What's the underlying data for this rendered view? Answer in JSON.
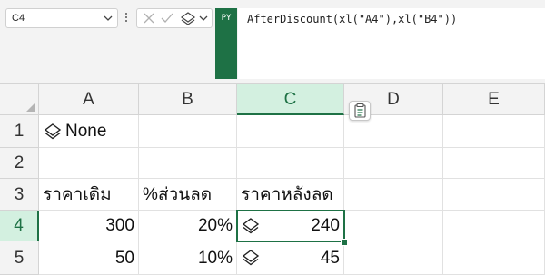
{
  "formula_bar": {
    "name_box": "C4",
    "py_badge": "PY",
    "formula": "AfterDiscount(xl(\"A4\"),xl(\"B4\"))"
  },
  "columns": [
    {
      "label": "A",
      "selected": false
    },
    {
      "label": "B",
      "selected": false
    },
    {
      "label": "C",
      "selected": true
    },
    {
      "label": "D",
      "selected": false
    },
    {
      "label": "E",
      "selected": false
    }
  ],
  "rows": [
    {
      "label": "1",
      "selected": false
    },
    {
      "label": "2",
      "selected": false
    },
    {
      "label": "3",
      "selected": false
    },
    {
      "label": "4",
      "selected": true
    },
    {
      "label": "5",
      "selected": false
    }
  ],
  "cells": {
    "A1": "None",
    "A3": "ราคาเดิม",
    "B3": "%ส่วนลด",
    "C3": "ราคาหลังลด",
    "A4": "300",
    "B4": "20%",
    "C4": "240",
    "A5": "50",
    "B5": "10%",
    "C5": "45"
  },
  "active_cell": "C4",
  "icons": {
    "name_box_dropdown": "chevron-down-icon",
    "cancel": "close-icon",
    "enter": "check-icon",
    "python_object": "stack-layers-icon",
    "quick_analysis": "quick-analysis-icon"
  },
  "colors": {
    "accent": "#1e7145",
    "selected_header_bg": "#d3f0e0"
  }
}
